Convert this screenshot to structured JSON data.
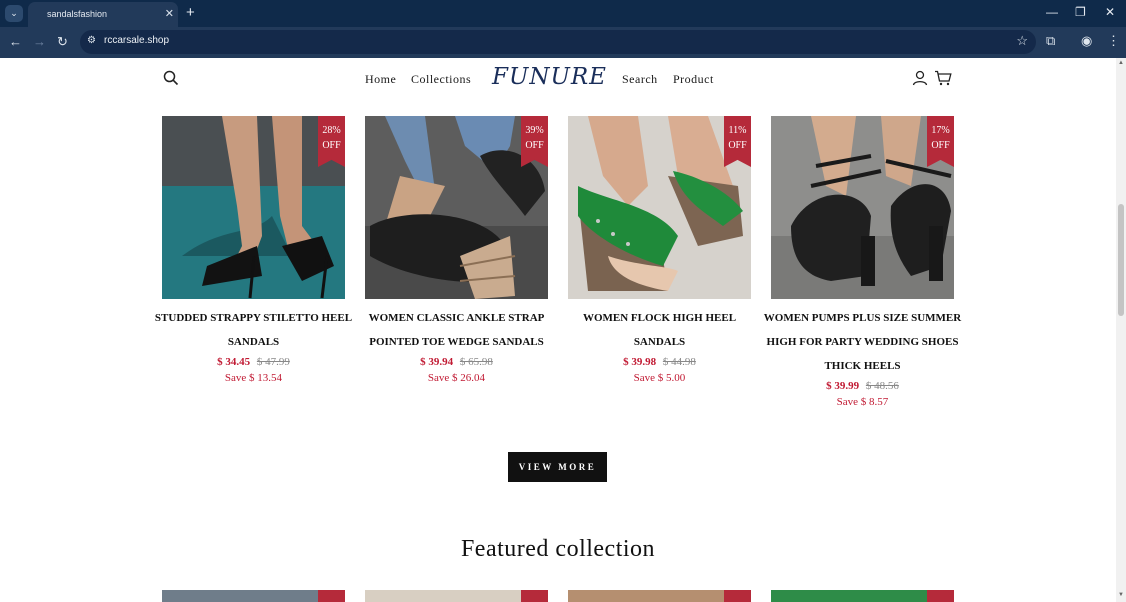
{
  "browser": {
    "tab_title": "sandalsfashion",
    "url": "rccarsale.shop",
    "new_tab_symbol": "+",
    "close_symbol": "✕"
  },
  "header": {
    "logo": "FUNURE",
    "nav": [
      "Home",
      "Collections",
      "Search",
      "Product"
    ]
  },
  "products": [
    {
      "name": "STUDDED STRAPPY STILETTO HEEL SANDALS",
      "discount": "28% OFF",
      "discount_pct": "28%",
      "discount_word": "OFF",
      "sale_price": "$ 34.45",
      "original_price": "$ 47.99",
      "save": "Save $ 13.54",
      "image_colors": [
        "#1f6b74",
        "#0e3a40"
      ]
    },
    {
      "name": "WOMEN CLASSIC ANKLE STRAP POINTED TOE WEDGE SANDALS",
      "discount": "39% OFF",
      "discount_pct": "39%",
      "discount_word": "OFF",
      "sale_price": "$ 39.94",
      "original_price": "$ 65.98",
      "save": "Save $ 26.04",
      "image_colors": [
        "#6b6b6b",
        "#3b3b3b"
      ]
    },
    {
      "name": "WOMEN FLOCK HIGH HEEL SANDALS",
      "discount": "11% OFF",
      "discount_pct": "11%",
      "discount_word": "OFF",
      "sale_price": "$ 39.98",
      "original_price": "$ 44.98",
      "save": "Save $ 5.00",
      "image_colors": [
        "#cfcbc5",
        "#a89f94"
      ]
    },
    {
      "name": "WOMEN PUMPS PLUS SIZE SUMMER HIGH FOR PARTY WEDDING SHOES THICK HEELS",
      "discount": "17% OFF",
      "discount_pct": "17%",
      "discount_word": "OFF",
      "sale_price": "$ 39.99",
      "original_price": "$ 48.56",
      "save": "Save $ 8.57",
      "image_colors": [
        "#9a9a98",
        "#6f6f6d"
      ]
    }
  ],
  "view_more": "VIEW MORE",
  "featured": {
    "title": "Featured collection"
  },
  "colors": {
    "accent": "#b52a3a",
    "sale": "#c11a33",
    "button": "#111111",
    "logo": "#1a2e5a"
  }
}
